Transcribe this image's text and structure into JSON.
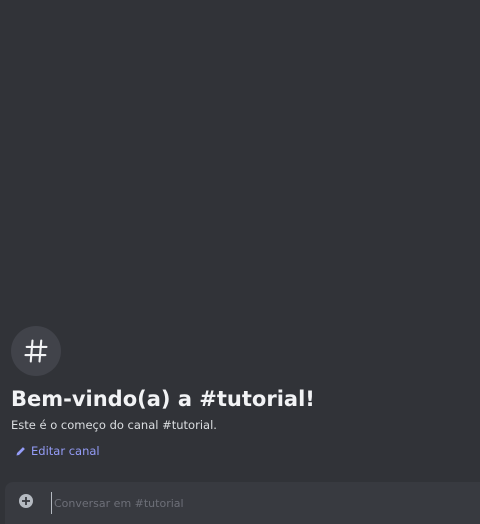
{
  "channel": {
    "welcome_title": "Bem-vindo(a) a #tutorial!",
    "welcome_subtitle": "Este é o começo do canal #tutorial.",
    "edit_label": "Editar canal"
  },
  "composer": {
    "placeholder": "Conversar em #tutorial",
    "value": ""
  },
  "icons": {
    "channel": "hashtag-icon",
    "edit": "pencil-icon",
    "attach": "plus-circle-icon"
  },
  "colors": {
    "background": "#313338",
    "composer_background": "#383a40",
    "link": "#949cf7",
    "title": "#f2f3f5"
  }
}
